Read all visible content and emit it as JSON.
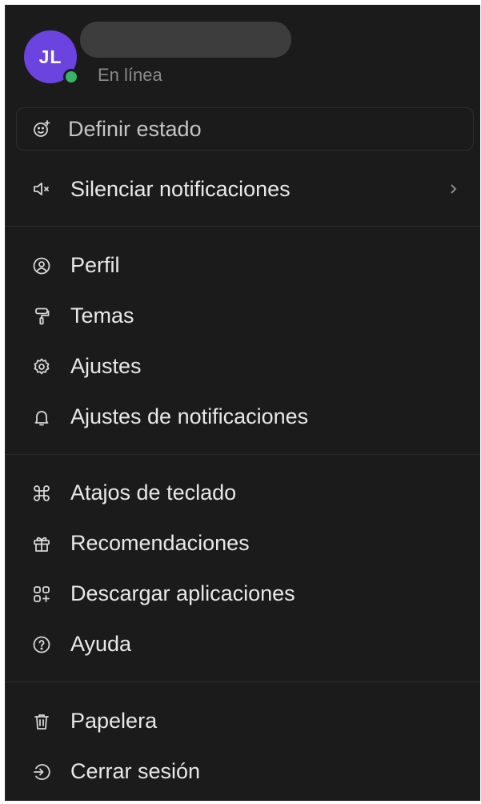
{
  "profile": {
    "initials": "JL",
    "status": "En línea",
    "avatar_color": "#6b44e0",
    "presence_color": "#35b46a"
  },
  "set_status": {
    "label": "Definir estado",
    "icon": "emoji-add-icon"
  },
  "mute": {
    "label": "Silenciar notificaciones",
    "icon": "speaker-mute-icon"
  },
  "group1": [
    {
      "label": "Perfil",
      "icon": "profile-icon"
    },
    {
      "label": "Temas",
      "icon": "paint-roller-icon"
    },
    {
      "label": "Ajustes",
      "icon": "gear-icon"
    },
    {
      "label": "Ajustes de notificaciones",
      "icon": "bell-icon"
    }
  ],
  "group2": [
    {
      "label": "Atajos de teclado",
      "icon": "command-key-icon"
    },
    {
      "label": "Recomendaciones",
      "icon": "gift-icon"
    },
    {
      "label": "Descargar aplicaciones",
      "icon": "apps-add-icon"
    },
    {
      "label": "Ayuda",
      "icon": "help-circle-icon"
    }
  ],
  "group3": [
    {
      "label": "Papelera",
      "icon": "trash-icon"
    },
    {
      "label": "Cerrar sesión",
      "icon": "logout-icon"
    }
  ]
}
